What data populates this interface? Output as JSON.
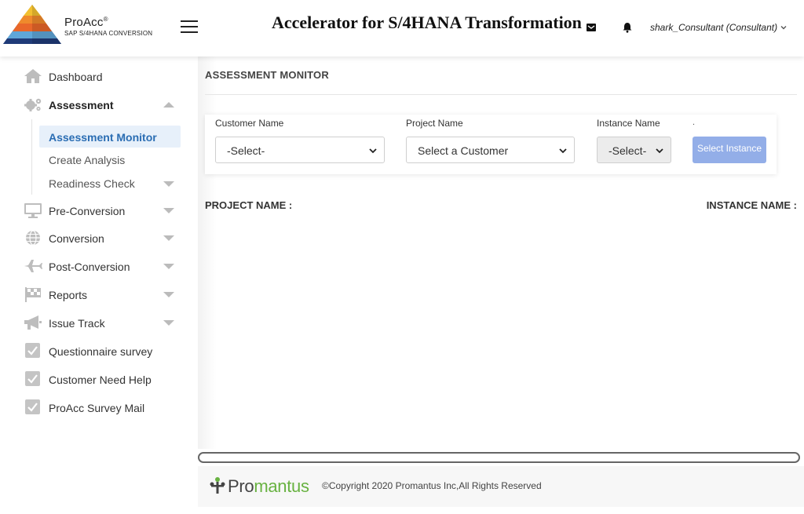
{
  "header": {
    "brand_name": "ProAcc",
    "brand_registered": "®",
    "brand_sub": "SAP S/4HANA CONVERSION",
    "title": "Accelerator for S/4HANA Transformation",
    "user": "shark_Consultant (Consultant)",
    "icons": [
      "menu-icon",
      "mail-icon",
      "bell-icon",
      "chevron-down-icon"
    ]
  },
  "sidebar": {
    "items": [
      {
        "label": "Dashboard",
        "icon": "home-icon"
      },
      {
        "label": "Assessment",
        "icon": "gears-icon",
        "expanded": true
      },
      {
        "label": "Pre-Conversion",
        "icon": "monitor-icon"
      },
      {
        "label": "Conversion",
        "icon": "globe-icon"
      },
      {
        "label": "Post-Conversion",
        "icon": "plane-icon"
      },
      {
        "label": "Reports",
        "icon": "flag-icon"
      },
      {
        "label": "Issue Track",
        "icon": "megaphone-icon"
      },
      {
        "label": "Questionnaire survey",
        "icon": "checkbox-icon"
      },
      {
        "label": "Customer Need Help",
        "icon": "checkbox-icon"
      },
      {
        "label": "ProAcc Survey Mail",
        "icon": "checkbox-icon"
      }
    ],
    "assessment_sub": [
      {
        "label": "Assessment Monitor",
        "active": true
      },
      {
        "label": "Create Analysis"
      },
      {
        "label": "Readiness Check"
      }
    ]
  },
  "main": {
    "page_title": "ASSESSMENT MONITOR",
    "filters": {
      "customer_label": "Customer Name",
      "customer_value": "-Select-",
      "project_label": "Project Name",
      "project_value": "Select a Customer",
      "instance_label": "Instance Name",
      "instance_value": "-Select-",
      "dot": ".",
      "button_label": "Select Instance"
    },
    "project_name_label": "PROJECT NAME :",
    "instance_name_label": "INSTANCE NAME :"
  },
  "footer": {
    "logo_pro": "Pro",
    "logo_mantus": "mantus",
    "copyright": "©Copyright 2020 Promantus Inc,All Rights Reserved"
  },
  "colors": {
    "accent": "#2a6db3",
    "button": "#93aee8",
    "footer_green": "#68b241"
  }
}
